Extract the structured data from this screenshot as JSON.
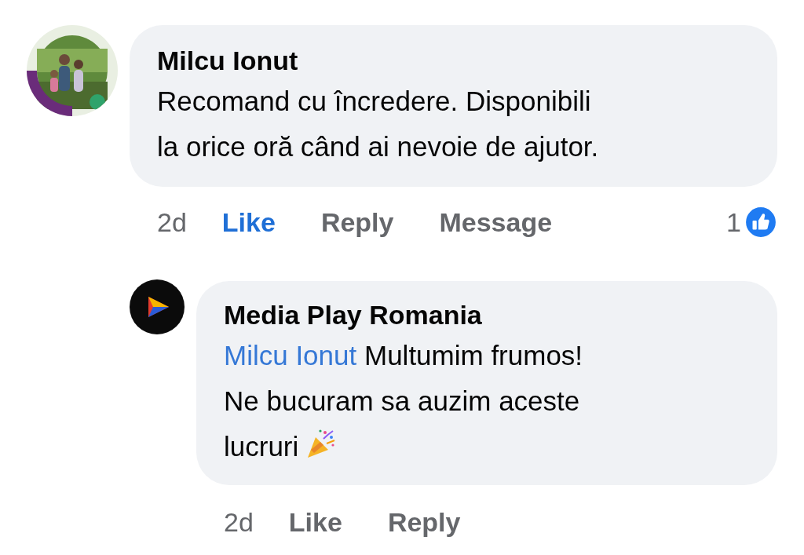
{
  "comments": [
    {
      "author": "Milcu Ionut",
      "avatar": {
        "kind": "picture"
      },
      "text_lines": [
        "Recomand cu încredere. Disponibili",
        "la orice oră când ai nevoie de ajutor."
      ],
      "time": "2d",
      "actions": [
        {
          "label": "Like",
          "selected": true
        },
        {
          "label": "Reply",
          "selected": false
        },
        {
          "label": "Message",
          "selected": false
        }
      ],
      "reaction_count": "1",
      "replies": [
        {
          "author": "Media Play Romania",
          "avatar": {
            "kind": "logo"
          },
          "mention": "Milcu Ionut",
          "text_lines": [
            "Multumim frumos!",
            "Ne bucuram sa auzim aceste",
            "lucruri"
          ],
          "emoji": true,
          "time": "2d",
          "actions": [
            {
              "label": "Like",
              "selected": false
            },
            {
              "label": "Reply",
              "selected": false
            }
          ]
        }
      ]
    }
  ]
}
